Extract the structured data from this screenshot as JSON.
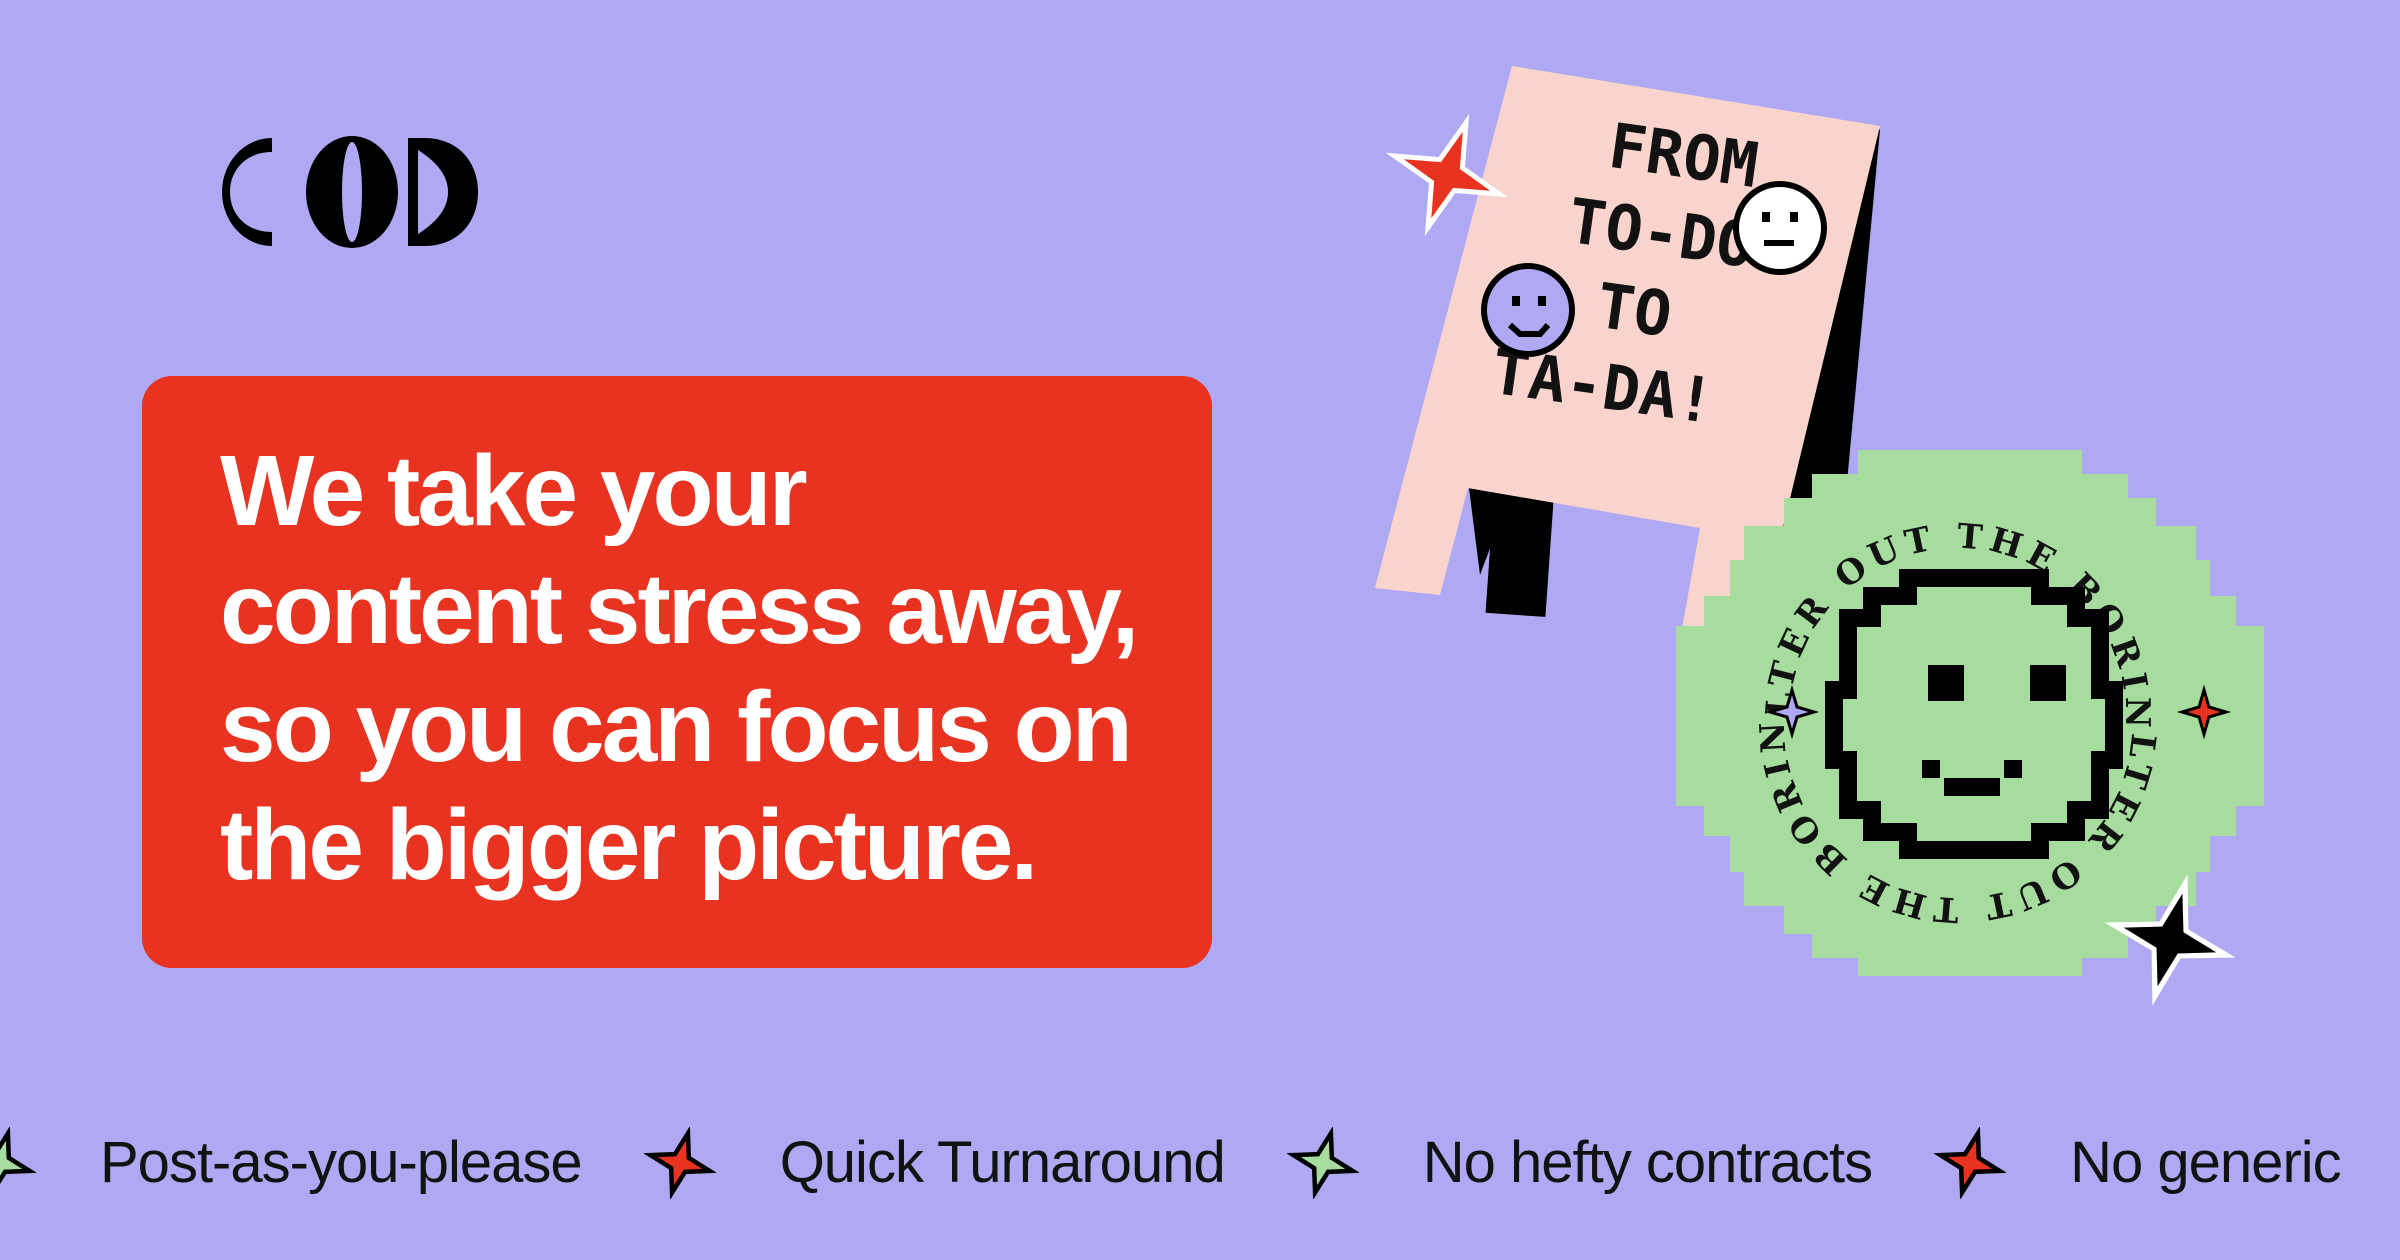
{
  "brand": {
    "logo_text": "COD",
    "colors": {
      "background": "#aea9f2",
      "card": "#e83321",
      "text_light": "#ffffff",
      "text_dark": "#121212",
      "pink": "#f9d4cc",
      "green": "#a6dd9f",
      "purple": "#aea9f2"
    }
  },
  "headline": {
    "lines": [
      "We take your",
      "content stress away,",
      "so you can focus on",
      "the bigger picture."
    ]
  },
  "sign": {
    "lines": [
      "FROM",
      "TO-DO",
      "TO",
      "TA-DA!"
    ]
  },
  "badge": {
    "ring_text_top": "FILTER OUT THE BORING",
    "ring_text_bottom": "FILTER OUT THE BORING"
  },
  "ticker": {
    "items": [
      {
        "label": "Post-as-you-please",
        "star": "green-star-icon"
      },
      {
        "label": "Quick Turnaround",
        "star": "red-star-icon"
      },
      {
        "label": "No hefty contracts",
        "star": "green-star-icon"
      },
      {
        "label": "No generic",
        "star": "red-star-icon"
      }
    ]
  }
}
